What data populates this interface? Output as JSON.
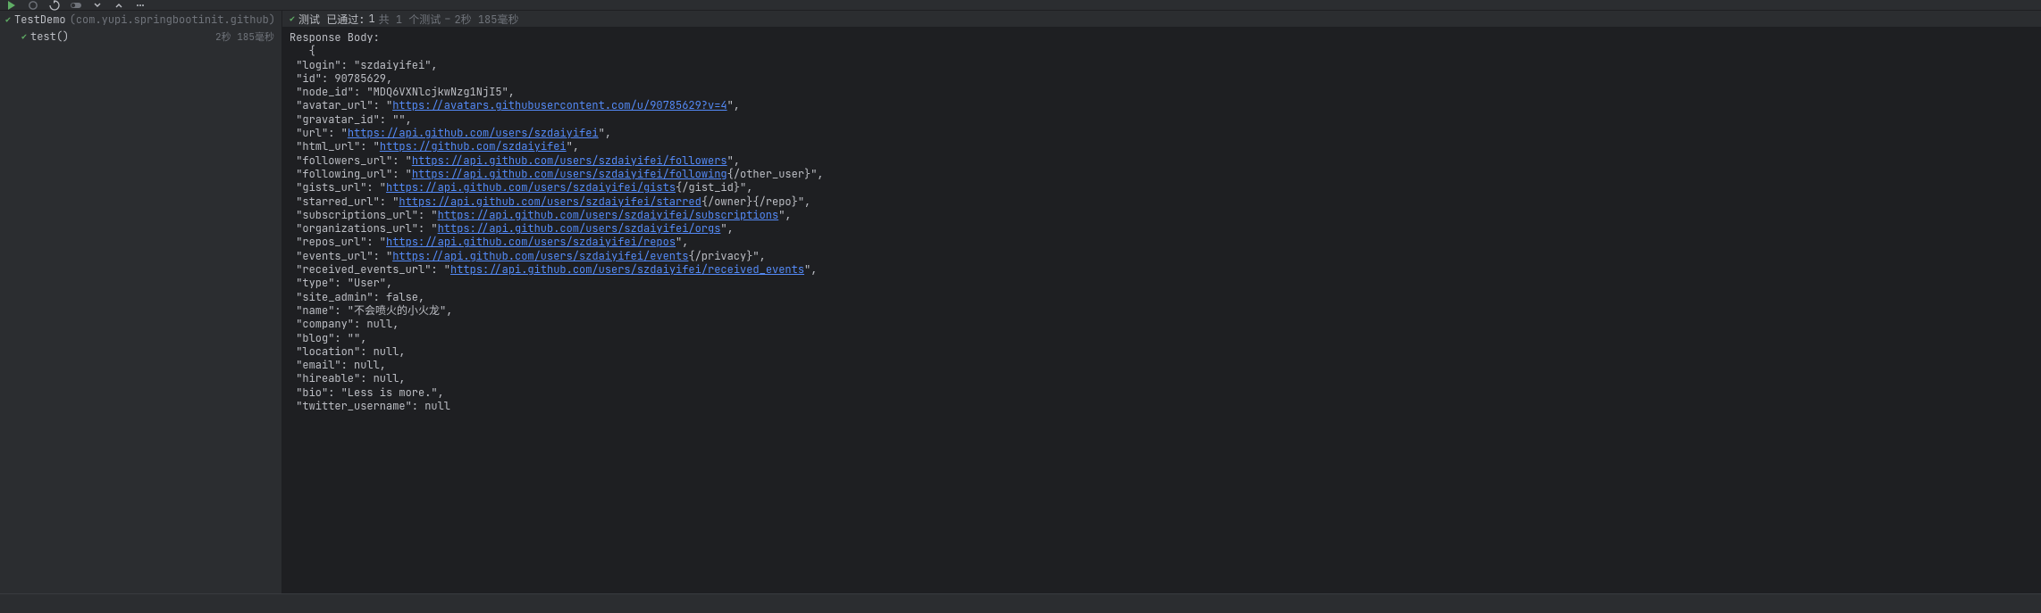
{
  "toolbar": {
    "icons": [
      "run-icon",
      "stop-icon",
      "rerun-icon",
      "toggle-icon",
      "expand-icon",
      "collapse-icon",
      "more-icon"
    ]
  },
  "tree": {
    "root": {
      "name": "TestDemo",
      "package": "(com.yupi.springbootinit.github)",
      "duration": "2秒 185毫秒"
    },
    "items": [
      {
        "name": "test()",
        "duration": "2秒 185毫秒"
      }
    ]
  },
  "status": {
    "prefix": "测试 已通过:",
    "passed": "1",
    "total_label": "共 1 个测试",
    "sep": " – ",
    "duration": "2秒 185毫秒"
  },
  "console": {
    "header": "Response Body:",
    "indent_brace": "   {",
    "lines": [
      {
        "pre": "\"login\": \"szdaiyifei\","
      },
      {
        "pre": "\"id\": 90785629,"
      },
      {
        "pre": "\"node_id\": \"MDQ6VXNlcjkwNzg1NjI5\","
      },
      {
        "pre": "\"avatar_url\": \"",
        "link": "https://avatars.githubusercontent.com/u/90785629?v=4",
        "post": "\","
      },
      {
        "pre": "\"gravatar_id\": \"\","
      },
      {
        "pre": "\"url\": \"",
        "link": "https://api.github.com/users/szdaiyifei",
        "post": "\","
      },
      {
        "pre": "\"html_url\": \"",
        "link": "https://github.com/szdaiyifei",
        "post": "\","
      },
      {
        "pre": "\"followers_url\": \"",
        "link": "https://api.github.com/users/szdaiyifei/followers",
        "post": "\","
      },
      {
        "pre": "\"following_url\": \"",
        "link": "https://api.github.com/users/szdaiyifei/following",
        "post": "{/other_user}\","
      },
      {
        "pre": "\"gists_url\": \"",
        "link": "https://api.github.com/users/szdaiyifei/gists",
        "post": "{/gist_id}\","
      },
      {
        "pre": "\"starred_url\": \"",
        "link": "https://api.github.com/users/szdaiyifei/starred",
        "post": "{/owner}{/repo}\","
      },
      {
        "pre": "\"subscriptions_url\": \"",
        "link": "https://api.github.com/users/szdaiyifei/subscriptions",
        "post": "\","
      },
      {
        "pre": "\"organizations_url\": \"",
        "link": "https://api.github.com/users/szdaiyifei/orgs",
        "post": "\","
      },
      {
        "pre": "\"repos_url\": \"",
        "link": "https://api.github.com/users/szdaiyifei/repos",
        "post": "\","
      },
      {
        "pre": "\"events_url\": \"",
        "link": "https://api.github.com/users/szdaiyifei/events",
        "post": "{/privacy}\","
      },
      {
        "pre": "\"received_events_url\": \"",
        "link": "https://api.github.com/users/szdaiyifei/received_events",
        "post": "\","
      },
      {
        "pre": "\"type\": \"User\","
      },
      {
        "pre": "\"site_admin\": false,"
      },
      {
        "pre": "\"name\": \"不会喷火的小火龙\","
      },
      {
        "pre": "\"company\": null,"
      },
      {
        "pre": "\"blog\": \"\","
      },
      {
        "pre": "\"location\": null,"
      },
      {
        "pre": "\"email\": null,"
      },
      {
        "pre": "\"hireable\": null,"
      },
      {
        "pre": "\"bio\": \"Less is more.\","
      },
      {
        "pre": "\"twitter_username\": null"
      }
    ]
  }
}
